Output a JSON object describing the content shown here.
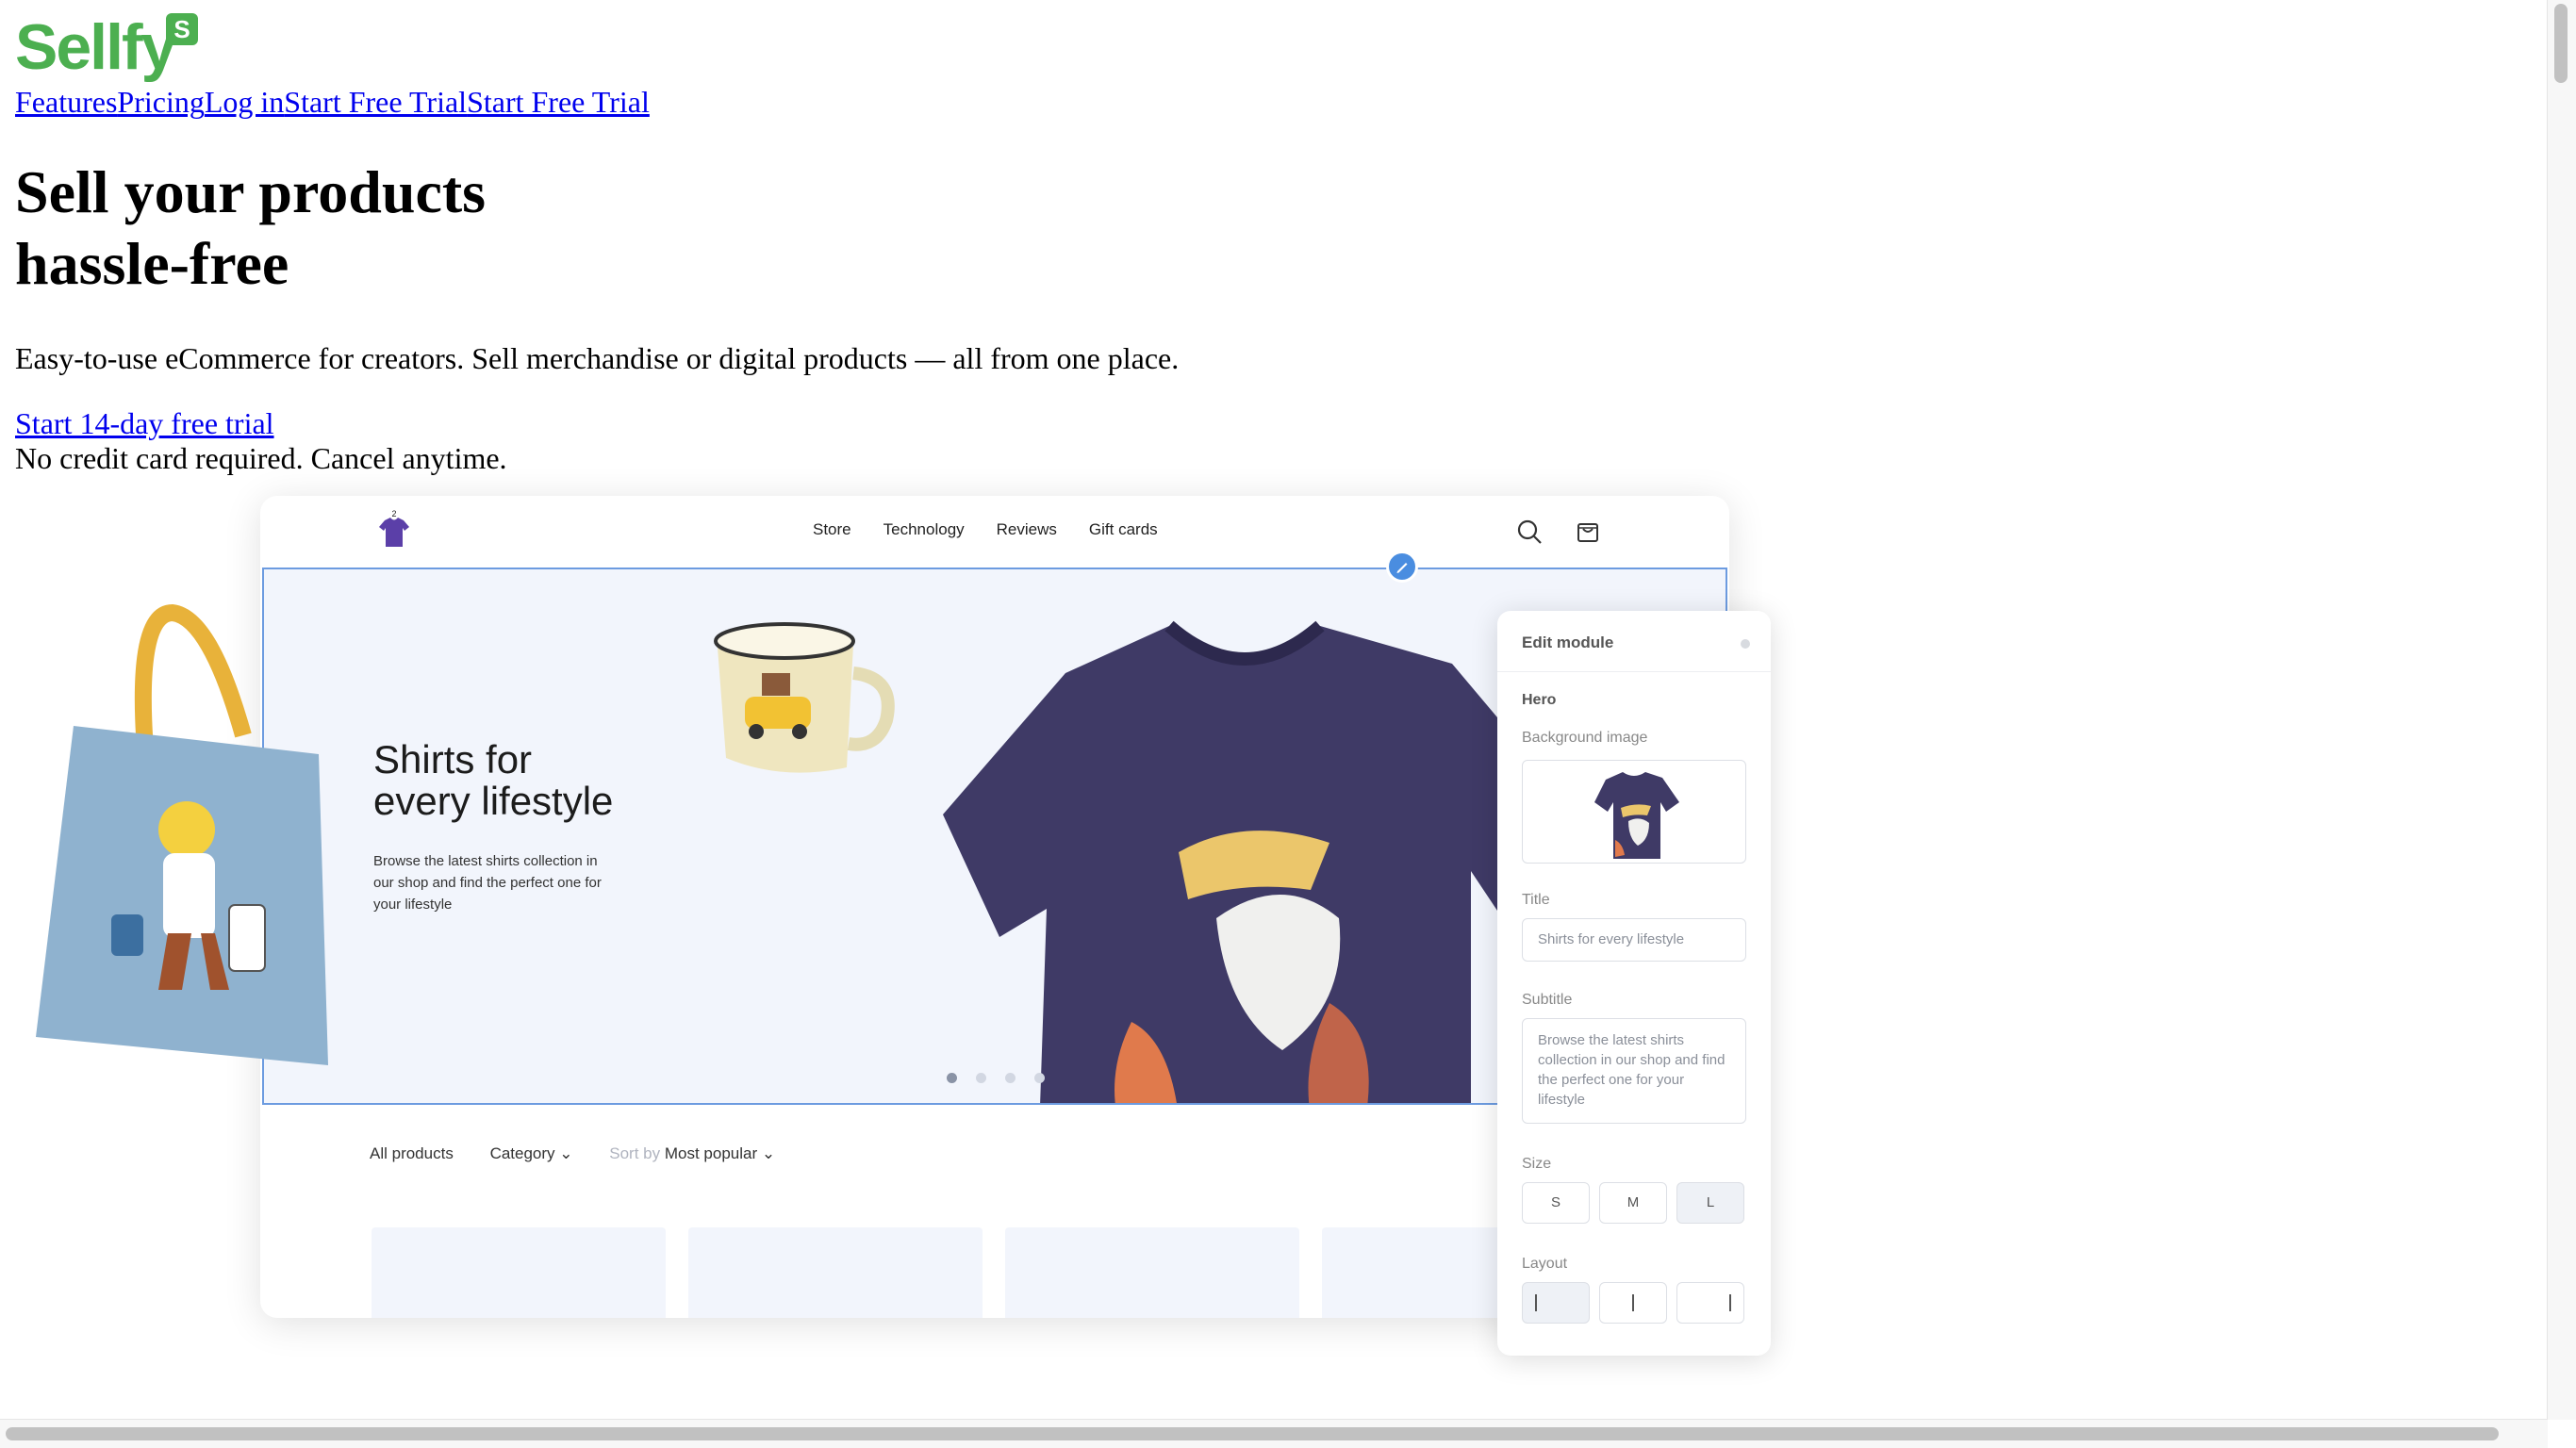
{
  "logo": {
    "text": "Sellfy",
    "badge": "S"
  },
  "nav": {
    "features": "Features",
    "pricing": "Pricing",
    "login": "Log in",
    "trial1": "Start Free Trial",
    "trial2": "Start Free Trial"
  },
  "hero": {
    "headline_line1": "Sell your products",
    "headline_line2": "hassle-free",
    "subtitle": "Easy-to-use eCommerce for creators. Sell merchandise or digital products — all from one place.",
    "cta": "Start 14-day free trial",
    "note": "No credit card required. Cancel anytime."
  },
  "mockup": {
    "nav_links": [
      "Store",
      "Technology",
      "Reviews",
      "Gift cards"
    ],
    "logo_badge": "2",
    "hero_title_line1": "Shirts for",
    "hero_title_line2": "every lifestyle",
    "hero_subtitle": "Browse the latest shirts collection in our shop and find the perfect one for your lifestyle",
    "filters": {
      "all": "All products",
      "category": "Category",
      "sort_label": "Sort by",
      "sort_value": "Most popular"
    }
  },
  "panel": {
    "title": "Edit module",
    "section": "Hero",
    "bg_label": "Background image",
    "title_label": "Title",
    "title_value": "Shirts for every lifestyle",
    "subtitle_label": "Subtitle",
    "subtitle_value": "Browse the latest shirts collection in our shop and find the perfect one for your lifestyle",
    "size_label": "Size",
    "sizes": [
      "S",
      "M",
      "L"
    ],
    "layout_label": "Layout"
  },
  "colors": {
    "brand": "#4caf50",
    "link": "#0000ee",
    "shirt": "#3f3a66",
    "tote": "#8fb2cf",
    "accent": "#4a8de0"
  }
}
